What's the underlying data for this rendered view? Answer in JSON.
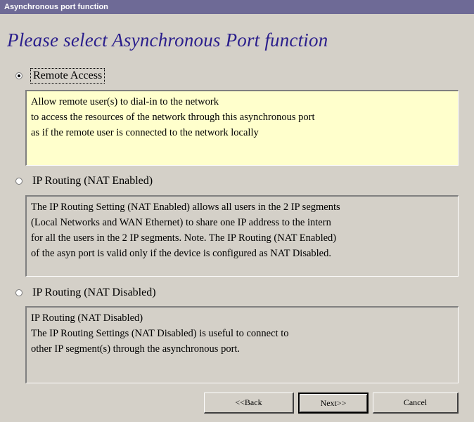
{
  "window": {
    "title": "Asynchronous port function"
  },
  "heading": "Please select Asynchronous Port function",
  "colors": {
    "title_bar": "#6e6a96",
    "heading": "#2a1e8c",
    "selected_desc_bg": "#ffffcc",
    "background": "#d4d0c8"
  },
  "options": [
    {
      "label": "Remote Access",
      "selected": true,
      "description": [
        "Allow remote user(s) to dial-in to the network",
        "to access the resources of the network through this asynchronous port",
        "as if the remote user is connected to the network locally"
      ]
    },
    {
      "label": "IP Routing (NAT Enabled)",
      "selected": false,
      "description": [
        "The IP Routing Setting (NAT Enabled) allows all users in the 2 IP segments",
        "(Local Networks and WAN Ethernet) to share one IP address to the intern",
        "for all the users in the 2 IP segments. Note. The IP Routing (NAT Enabled)",
        "of the asyn port is valid only if the device is configured as NAT Disabled."
      ]
    },
    {
      "label": "IP Routing (NAT Disabled)",
      "selected": false,
      "description": [
        "IP Routing (NAT Disabled)",
        "The IP Routing Settings (NAT Disabled) is useful to connect to",
        "other IP segment(s) through the asynchronous port."
      ]
    }
  ],
  "buttons": {
    "back": "<<Back",
    "next": "Next>>",
    "cancel": "Cancel"
  }
}
